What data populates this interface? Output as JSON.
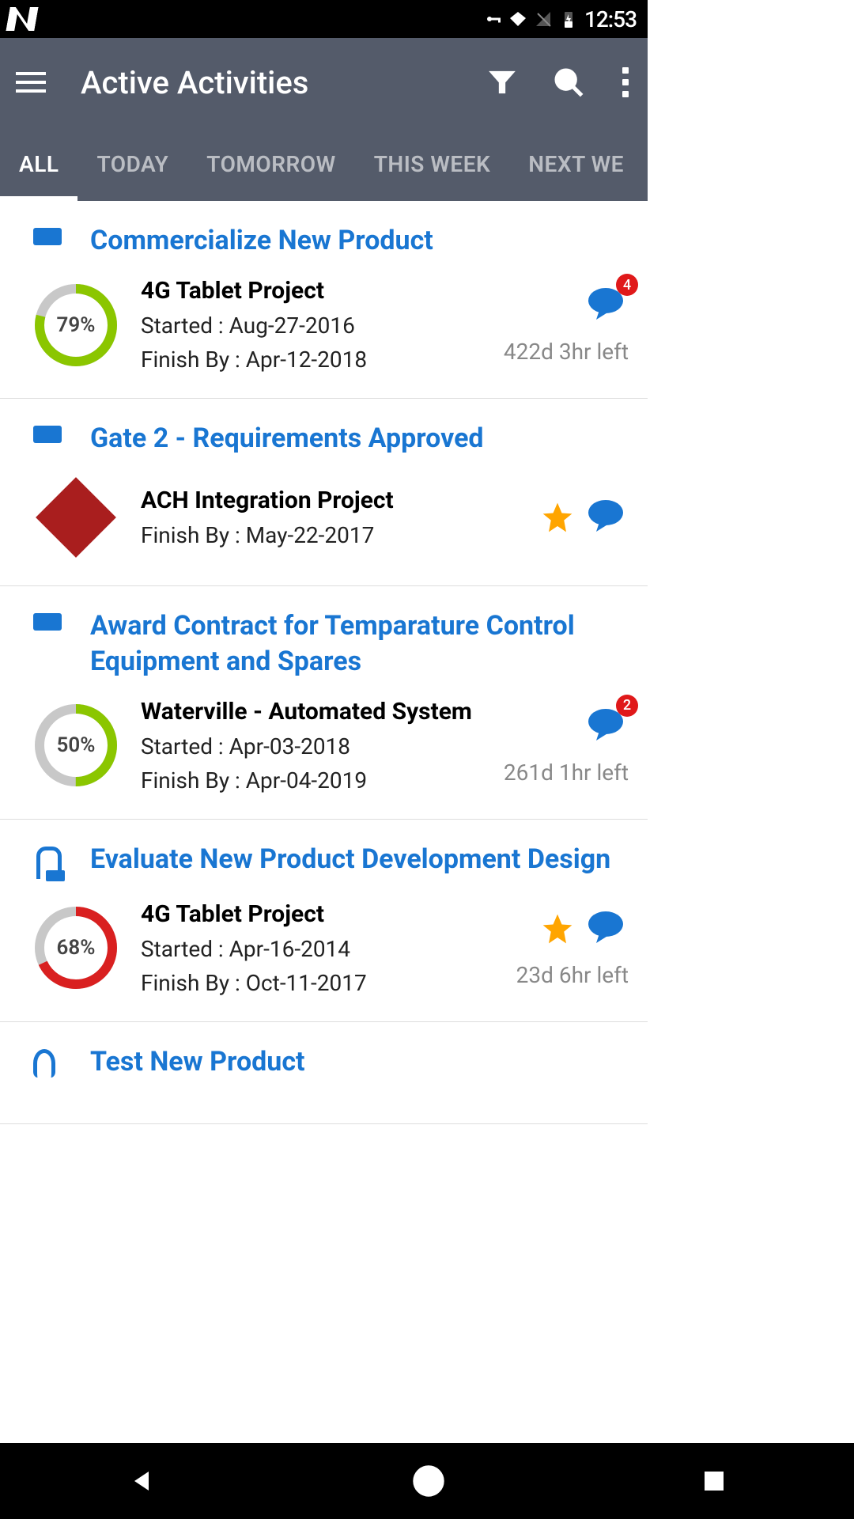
{
  "status": {
    "time": "12:53"
  },
  "appbar": {
    "title": "Active Activities"
  },
  "tabs": [
    "ALL",
    "TODAY",
    "TOMORROW",
    "THIS WEEK",
    "NEXT WE"
  ],
  "activeTab": 0,
  "colors": {
    "ringGreen": "#8bc600",
    "ringRed": "#d92020",
    "ringTrack": "#c8c8c8"
  },
  "activities": [
    {
      "headerIcon": "bar",
      "title": "Commercialize New Product",
      "progressIcon": "ring",
      "percent": 79,
      "ringColor": "green",
      "project": "4G Tablet Project",
      "started": "Started : Aug-27-2016",
      "finish": "Finish By : Apr-12-2018",
      "starred": false,
      "chatBadge": "4",
      "timeLeft": "422d 3hr left"
    },
    {
      "headerIcon": "bar",
      "title": "Gate 2 - Requirements Approved",
      "progressIcon": "diamond",
      "project": "ACH Integration Project",
      "finish": "Finish By : May-22-2017",
      "starred": true,
      "chatBadge": null
    },
    {
      "headerIcon": "bar",
      "title": "Award Contract for Temparature Control Equipment and Spares",
      "progressIcon": "ring",
      "percent": 50,
      "ringColor": "green",
      "project": "Waterville - Automated System",
      "started": "Started : Apr-03-2018",
      "finish": "Finish By : Apr-04-2019",
      "starred": false,
      "chatBadge": "2",
      "timeLeft": "261d 1hr left"
    },
    {
      "headerIcon": "person",
      "title": "Evaluate New Product Development Design",
      "progressIcon": "ring",
      "percent": 68,
      "ringColor": "red",
      "project": "4G Tablet Project",
      "started": "Started : Apr-16-2014",
      "finish": "Finish By : Oct-11-2017",
      "starred": true,
      "chatBadge": null,
      "timeLeft": "23d 6hr left"
    },
    {
      "headerIcon": "lightbulb",
      "title": "Test New Product"
    }
  ]
}
